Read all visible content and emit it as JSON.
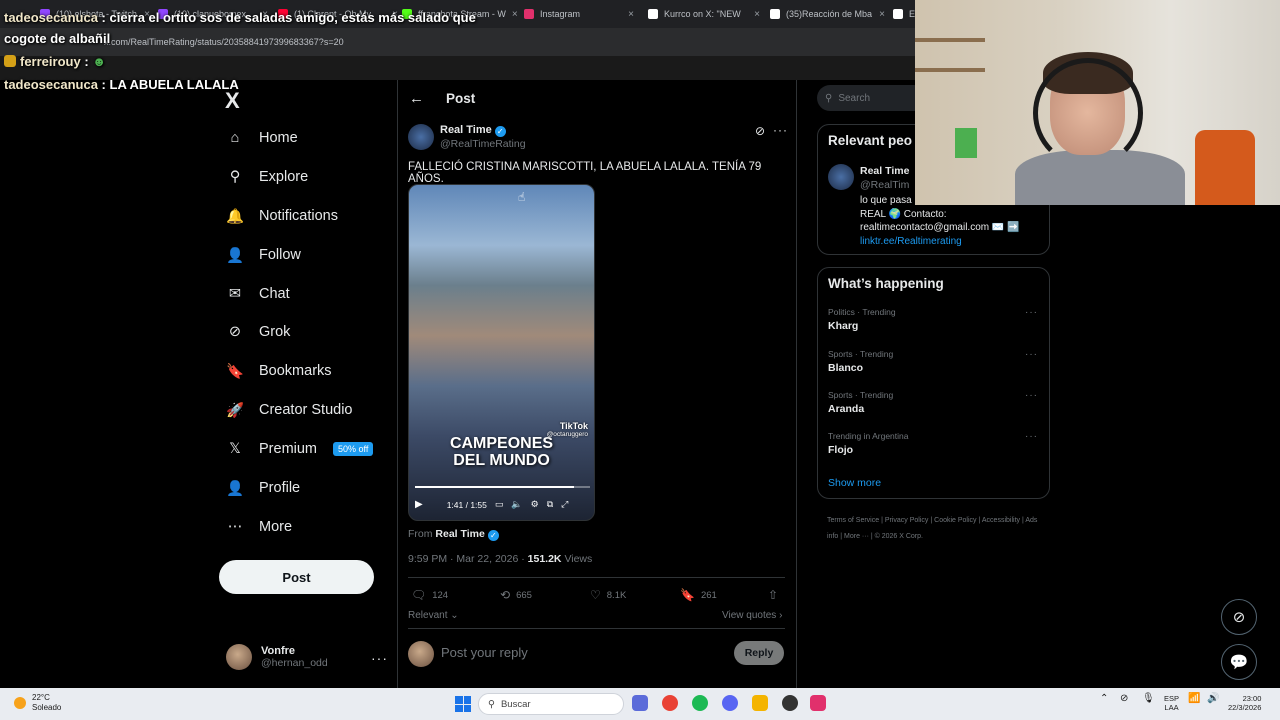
{
  "browser": {
    "tabs": [
      {
        "label": "(10) elshota - Twitch",
        "color": "#9146ff"
      },
      {
        "label": "(10) clanuebomex",
        "color": "#9146ff"
      },
      {
        "label": "(1) Clarent - Oh My",
        "color": "#ff0033"
      },
      {
        "label": "ffranchota Stream - W",
        "color": "#53fc18"
      },
      {
        "label": "Instagram",
        "color": "#e1306c"
      },
      {
        "label": "Kurrco on X: \"NEW",
        "color": "#ffffff"
      },
      {
        "label": "(35)Reacción de Mba",
        "color": "#ffffff"
      },
      {
        "label": "E",
        "color": "#ffffff"
      }
    ],
    "url": "x.com/RealTimeRating/status/2035884197399683367?s=20"
  },
  "chat_overlay": [
    {
      "user": "tadeosecanuca",
      "message": "cierra el ortito sos de saladas amigo, estás más salado que"
    },
    {
      "user": "",
      "message": "cogote de albañil"
    },
    {
      "user": "ferreirouy",
      "message": ""
    },
    {
      "user": "tadeosecanuca",
      "message": "LA ABUELA LALALA"
    }
  ],
  "nav": {
    "logo": "X",
    "items": [
      {
        "label": "Home",
        "icon": "home-icon",
        "glyph": "⌂"
      },
      {
        "label": "Explore",
        "icon": "search-icon",
        "glyph": "⚲"
      },
      {
        "label": "Notifications",
        "icon": "bell-icon",
        "glyph": "🔔"
      },
      {
        "label": "Follow",
        "icon": "person-plus-icon",
        "glyph": "👤"
      },
      {
        "label": "Chat",
        "icon": "mail-icon",
        "glyph": "✉"
      },
      {
        "label": "Grok",
        "icon": "grok-icon",
        "glyph": "⊘"
      },
      {
        "label": "Bookmarks",
        "icon": "bookmark-icon",
        "glyph": "🔖"
      },
      {
        "label": "Creator Studio",
        "icon": "rocket-icon",
        "glyph": "🚀"
      },
      {
        "label": "Premium",
        "icon": "x-icon",
        "glyph": "𝕏",
        "badge": "50% off"
      },
      {
        "label": "Profile",
        "icon": "person-icon",
        "glyph": "👤"
      },
      {
        "label": "More",
        "icon": "more-circle-icon",
        "glyph": "⋯"
      }
    ],
    "post_button": "Post",
    "account": {
      "name": "Vonfre",
      "handle": "@hernan_odd"
    }
  },
  "post": {
    "header_title": "Post",
    "author_name": "Real Time",
    "author_handle": "@RealTimeRating",
    "text": "FALLECIÓ CRISTINA MARISCOTTI, LA ABUELA LALALA. TENÍA 79 AÑOS.",
    "video": {
      "overlay_line1": "CAMPEONES",
      "overlay_line2": "DEL MUNDO",
      "tiktok_label": "TikTok",
      "tiktok_user": "@octaruggero",
      "time": "1:41 / 1:55",
      "progress": 0.91
    },
    "from_label": "From",
    "from_name": "Real Time",
    "timestamp": "9:59 PM · Mar 22, 2026 ·",
    "views_count": "151.2K",
    "views_label": "Views",
    "actions": {
      "replies": "124",
      "reposts": "665",
      "likes": "8.1K",
      "bookmarks": "261"
    },
    "sort_label": "Relevant",
    "view_quotes": "View quotes",
    "reply_placeholder": "Post your reply",
    "reply_button": "Reply"
  },
  "right": {
    "search_placeholder": "Search",
    "relevant_title": "Relevant peo",
    "relevant_person": {
      "name": "Real Time",
      "handle": "@RealTim",
      "bio_line1": "lo que pasa",
      "bio_line2": "REAL 🌍 Contacto:",
      "bio_line3": "realtimecontacto@gmail.com ✉️ ➡️",
      "bio_link": "linktr.ee/Realtimerating"
    },
    "happening_title": "What’s happening",
    "trends": [
      {
        "category": "Politics · Trending",
        "name": "Kharg"
      },
      {
        "category": "Sports · Trending",
        "name": "Blanco"
      },
      {
        "category": "Sports · Trending",
        "name": "Aranda"
      },
      {
        "category": "Trending in Argentina",
        "name": "Flojo"
      }
    ],
    "show_more": "Show more",
    "footer": [
      "Terms of Service",
      "Privacy Policy",
      "Cookie Policy",
      "Accessibility",
      "Ads info",
      "More ···",
      "© 2026 X Corp."
    ]
  },
  "taskbar": {
    "temperature": "22°C",
    "weather": "Soleado",
    "search_placeholder": "Buscar",
    "lang_line1": "ESP",
    "lang_line2": "LAA",
    "time": "23:00",
    "date": "22/3/2026"
  }
}
